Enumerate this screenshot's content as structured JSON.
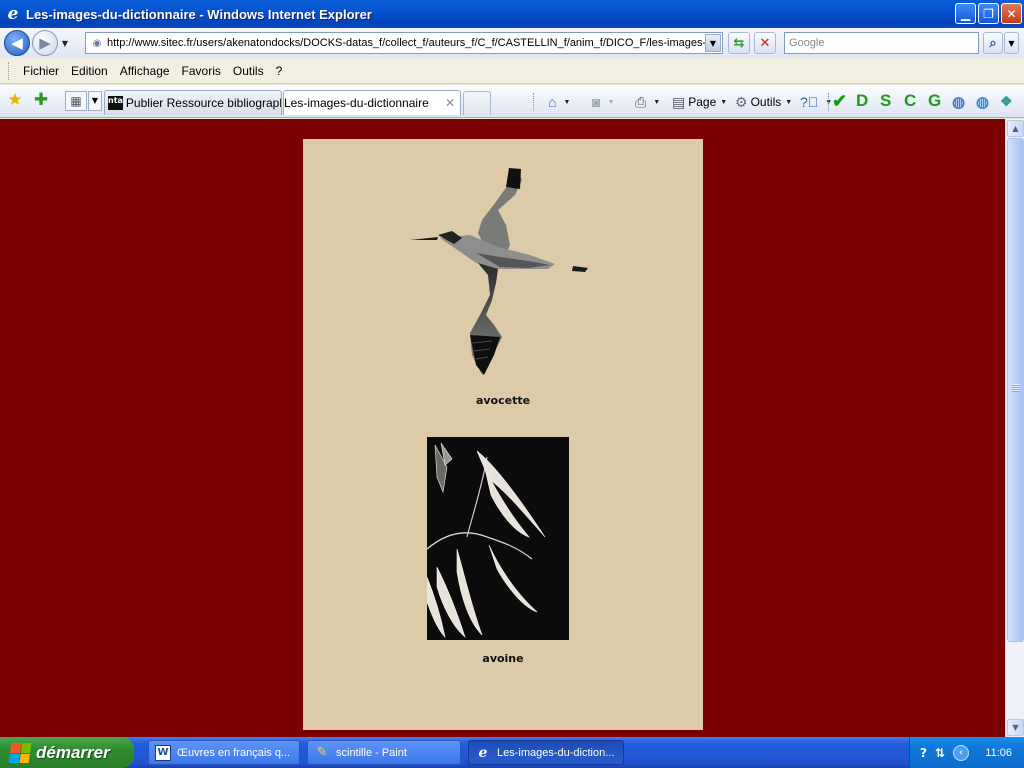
{
  "window": {
    "title": "Les-images-du-dictionnaire - Windows Internet Explorer"
  },
  "address": {
    "url": "http://www.sitec.fr/users/akenatondocks/DOCKS-datas_f/collect_f/auteurs_f/C_f/CASTELLIN_f/anim_f/DICO_F/les-images-",
    "search_placeholder": "Google"
  },
  "menu": {
    "items": [
      "Fichier",
      "Edition",
      "Affichage",
      "Favoris",
      "Outils",
      "?"
    ]
  },
  "tabs": [
    {
      "label": "Publier Ressource bibliograph...",
      "icon": "nta"
    },
    {
      "label": "Les-images-du-dictionnaire",
      "icon": "page"
    }
  ],
  "tab_icon_text": "nta",
  "commandbar": {
    "page_label": "Page",
    "tools_label": "Outils",
    "letters": [
      "D",
      "S",
      "C",
      "G"
    ]
  },
  "content": {
    "captions": [
      "avocette",
      "avoine"
    ]
  },
  "taskbar": {
    "start_label": "démarrer",
    "items": [
      {
        "label": "Œuvres en français q...",
        "icon": "word-icon"
      },
      {
        "label": "scintille - Paint",
        "icon": "paint-icon"
      },
      {
        "label": "Les-images-du-diction...",
        "icon": "ie-icon"
      }
    ],
    "word_icon_text": "W",
    "clock": "11:06"
  }
}
